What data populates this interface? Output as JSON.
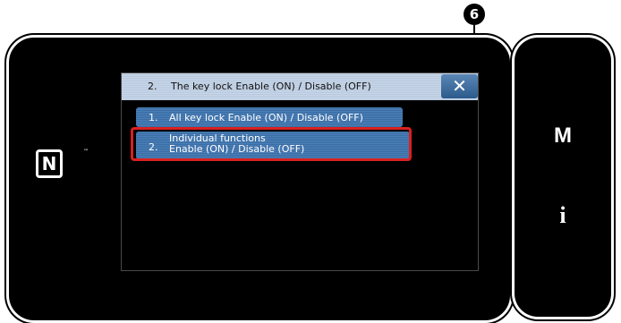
{
  "callout": {
    "number": "6"
  },
  "device": {
    "nfc_logo": "N",
    "nfc_trademark": "™",
    "side_buttons": {
      "mode": "M",
      "info": "i"
    }
  },
  "screen": {
    "title_number": "2.",
    "title_text": "The key lock Enable (ON) / Disable (OFF)",
    "close_symbol": "✕",
    "menu": [
      {
        "number": "1.",
        "label": "All key lock Enable (ON) / Disable (OFF)"
      },
      {
        "number": "2.",
        "label_line1": "Individual functions",
        "label_line2": "Enable (ON) / Disable (OFF)"
      }
    ]
  },
  "colors": {
    "highlight": "#d92020",
    "button_blue": "#4a7fb8",
    "title_bar": "#c9d7e8"
  }
}
